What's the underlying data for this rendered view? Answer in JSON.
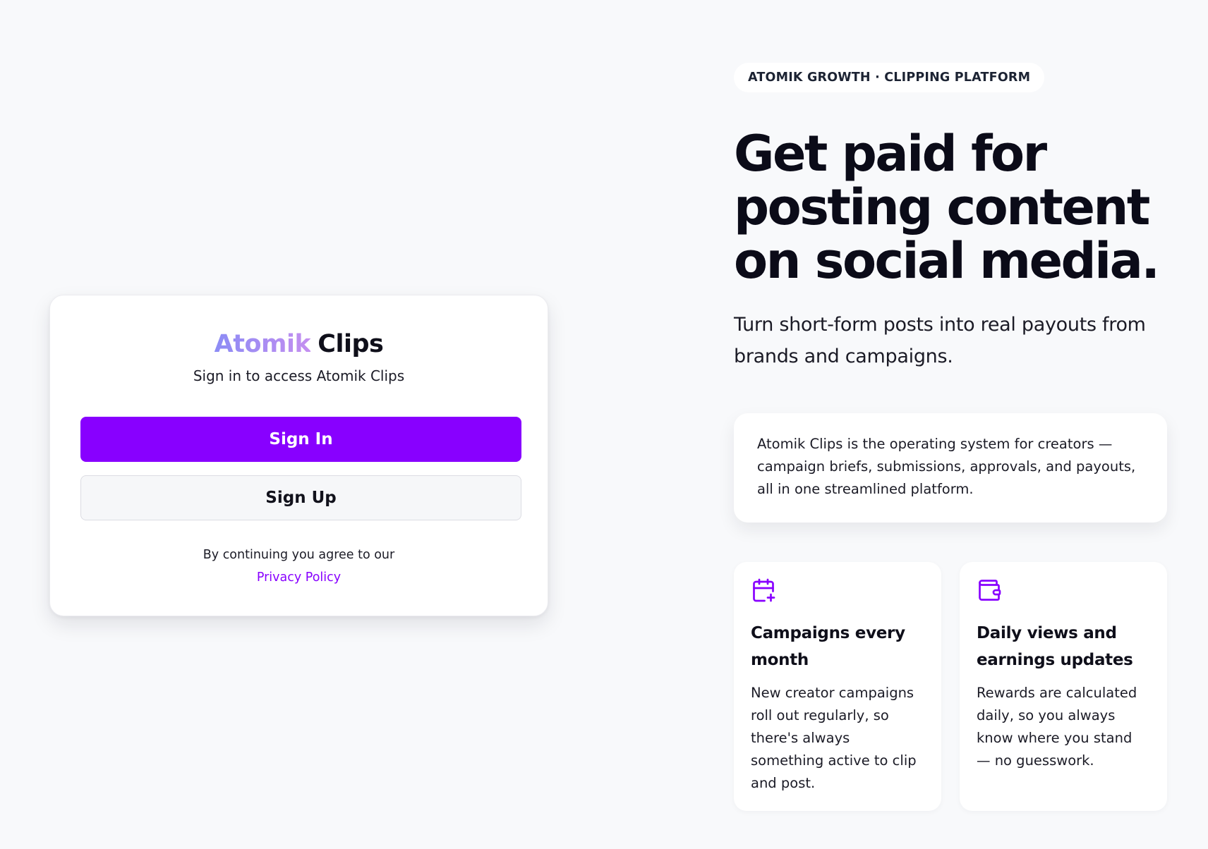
{
  "login": {
    "brand_accent": "Atomik",
    "brand_main": "Clips",
    "subtitle": "Sign in to access Atomik Clips",
    "sign_in_label": "Sign In",
    "sign_up_label": "Sign Up",
    "legal_text": "By continuing you agree to our",
    "privacy_link": "Privacy Policy"
  },
  "hero": {
    "tagline": "ATOMIK GROWTH · CLIPPING PLATFORM",
    "headline": "Get paid for posting content on social media.",
    "subheadline": "Turn short-form posts into real payouts from brands and campaigns."
  },
  "info_card": {
    "text": "Atomik Clips is the operating system for creators — campaign briefs, submissions, approvals, and payouts, all in one streamlined platform."
  },
  "features": [
    {
      "icon": "calendar-plus-icon",
      "title": "Campaigns every month",
      "description": "New creator campaigns roll out regularly, so there's always something active to clip and post."
    },
    {
      "icon": "wallet-icon",
      "title": "Daily views and earnings updates",
      "description": "Rewards are calculated daily, so you always know where you stand — no guesswork."
    }
  ],
  "colors": {
    "primary": "#8800ff",
    "background": "#f8f9fb",
    "text": "#0f0f1a",
    "brand_gradient_start": "#8c8cf5",
    "brand_gradient_end": "#c48ef0"
  }
}
